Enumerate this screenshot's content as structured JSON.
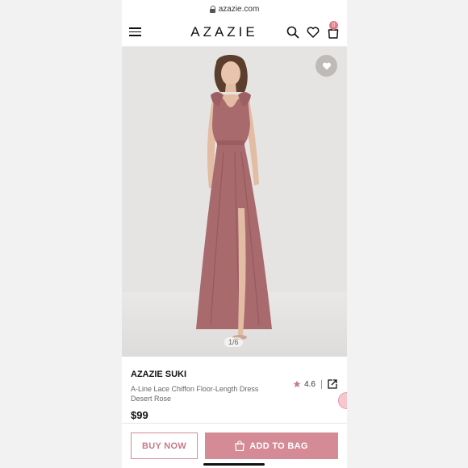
{
  "browser": {
    "url": "azazie.com"
  },
  "header": {
    "logo": "AZAZIE",
    "icons": [
      "menu-icon",
      "search-icon",
      "heart-icon",
      "bag-icon"
    ],
    "bag_count": "0"
  },
  "gallery": {
    "counter": "1/6"
  },
  "product": {
    "brand": "AZAZIE SUKI",
    "name": "A-Line Lace Chiffon Floor-Length Dress",
    "color": "Desert Rose",
    "price": "$99",
    "rating": "4.6"
  },
  "actions": {
    "buy_now": "BUY NOW",
    "add_to_bag": "ADD TO BAG"
  },
  "colors": {
    "accent": "#d58b96",
    "dress": "#a86a6d",
    "badge": "#e07b8a"
  }
}
